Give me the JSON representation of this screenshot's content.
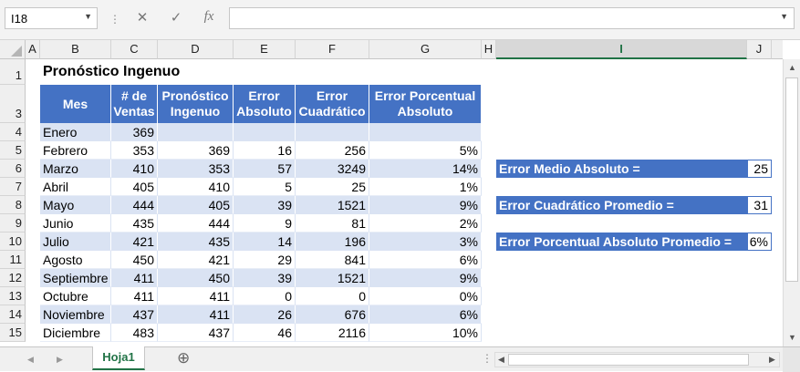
{
  "formula_bar": {
    "name_box": "I18",
    "cancel_icon": "✕",
    "confirm_icon": "✓",
    "fx_label": "fx",
    "formula": ""
  },
  "columns": [
    "A",
    "B",
    "C",
    "D",
    "E",
    "F",
    "G",
    "H",
    "I",
    "J"
  ],
  "selected_column": "I",
  "rows": [
    "1",
    "3",
    "4",
    "5",
    "6",
    "7",
    "8",
    "9",
    "10",
    "11",
    "12",
    "13",
    "14",
    "15"
  ],
  "title": "Pronóstico Ingenuo",
  "table": {
    "headers": [
      {
        "line1": "Mes",
        "line2": ""
      },
      {
        "line1": "# de",
        "line2": "Ventas"
      },
      {
        "line1": "Pronóstico",
        "line2": "Ingenuo"
      },
      {
        "line1": "Error",
        "line2": "Absoluto"
      },
      {
        "line1": "Error",
        "line2": "Cuadrático"
      },
      {
        "line1": "Error Porcentual",
        "line2": "Absoluto"
      }
    ],
    "rows": [
      {
        "mes": "Enero",
        "ventas": "369",
        "pronostico": "",
        "abs": "",
        "cuad": "",
        "pct": ""
      },
      {
        "mes": "Febrero",
        "ventas": "353",
        "pronostico": "369",
        "abs": "16",
        "cuad": "256",
        "pct": "5%"
      },
      {
        "mes": "Marzo",
        "ventas": "410",
        "pronostico": "353",
        "abs": "57",
        "cuad": "3249",
        "pct": "14%"
      },
      {
        "mes": "Abril",
        "ventas": "405",
        "pronostico": "410",
        "abs": "5",
        "cuad": "25",
        "pct": "1%"
      },
      {
        "mes": "Mayo",
        "ventas": "444",
        "pronostico": "405",
        "abs": "39",
        "cuad": "1521",
        "pct": "9%"
      },
      {
        "mes": "Junio",
        "ventas": "435",
        "pronostico": "444",
        "abs": "9",
        "cuad": "81",
        "pct": "2%"
      },
      {
        "mes": "Julio",
        "ventas": "421",
        "pronostico": "435",
        "abs": "14",
        "cuad": "196",
        "pct": "3%"
      },
      {
        "mes": "Agosto",
        "ventas": "450",
        "pronostico": "421",
        "abs": "29",
        "cuad": "841",
        "pct": "6%"
      },
      {
        "mes": "Septiembre",
        "ventas": "411",
        "pronostico": "450",
        "abs": "39",
        "cuad": "1521",
        "pct": "9%"
      },
      {
        "mes": "Octubre",
        "ventas": "411",
        "pronostico": "411",
        "abs": "0",
        "cuad": "0",
        "pct": "0%"
      },
      {
        "mes": "Noviembre",
        "ventas": "437",
        "pronostico": "411",
        "abs": "26",
        "cuad": "676",
        "pct": "6%"
      },
      {
        "mes": "Diciembre",
        "ventas": "483",
        "pronostico": "437",
        "abs": "46",
        "cuad": "2116",
        "pct": "10%"
      }
    ]
  },
  "metrics": [
    {
      "label": "Error Medio Absoluto =",
      "value": "25"
    },
    {
      "label": "Error Cuadrático Promedio =",
      "value": "31"
    },
    {
      "label": "Error Porcentual Absoluto Promedio =",
      "value": "6%"
    }
  ],
  "tabs": {
    "sheet": "Hoja1",
    "add_icon": "⊕"
  },
  "colors": {
    "header_blue": "#4472c4",
    "band_blue": "#dae3f3",
    "excel_green": "#217346"
  }
}
